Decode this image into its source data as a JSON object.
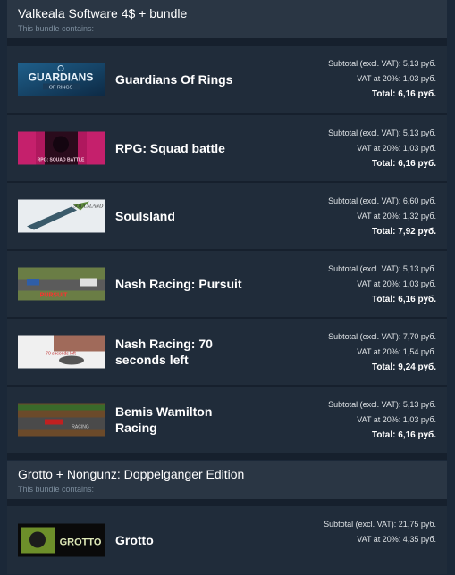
{
  "bundles": [
    {
      "title": "Valkeala Software 4$ + bundle",
      "subtitle": "This bundle contains:",
      "items": [
        {
          "name": "Guardians Of Rings",
          "capsule_text": "GUARDIANS",
          "capsule_text2": "OF RINGS",
          "subtotal": "Subtotal (excl. VAT): 5,13 руб.",
          "vat": "VAT at 20%: 1,03 руб.",
          "total": "Total: 6,16 руб."
        },
        {
          "name": "RPG: Squad battle",
          "capsule_text": "RPG: SQUAD BATTLE",
          "subtotal": "Subtotal (excl. VAT): 5,13 руб.",
          "vat": "VAT at 20%: 1,03 руб.",
          "total": "Total: 6,16 руб."
        },
        {
          "name": "Soulsland",
          "capsule_text": "SOULSLAND",
          "subtotal": "Subtotal (excl. VAT): 6,60 руб.",
          "vat": "VAT at 20%: 1,32 руб.",
          "total": "Total: 7,92 руб."
        },
        {
          "name": "Nash Racing: Pursuit",
          "capsule_text": "PURSUIT",
          "subtotal": "Subtotal (excl. VAT): 5,13 руб.",
          "vat": "VAT at 20%: 1,03 руб.",
          "total": "Total: 6,16 руб."
        },
        {
          "name": "Nash Racing: 70 seconds left",
          "capsule_text": "70 seconds left",
          "subtotal": "Subtotal (excl. VAT): 7,70 руб.",
          "vat": "VAT at 20%: 1,54 руб.",
          "total": "Total: 9,24 руб."
        },
        {
          "name": "Bemis Wamilton Racing",
          "capsule_text": "RACING",
          "subtotal": "Subtotal (excl. VAT): 5,13 руб.",
          "vat": "VAT at 20%: 1,03 руб.",
          "total": "Total: 6,16 руб."
        }
      ]
    },
    {
      "title": "Grotto + Nongunz: Doppelganger Edition",
      "subtitle": "This bundle contains:",
      "items": [
        {
          "name": "Grotto",
          "capsule_text": "GROTTO",
          "subtotal": "Subtotal (excl. VAT): 21,75 руб.",
          "vat": "VAT at 20%: 4,35 руб."
        }
      ]
    }
  ],
  "colors": {
    "page_bg": "#1b2838",
    "header_bg": "#2a3644",
    "row_bg": "#202c3a"
  }
}
